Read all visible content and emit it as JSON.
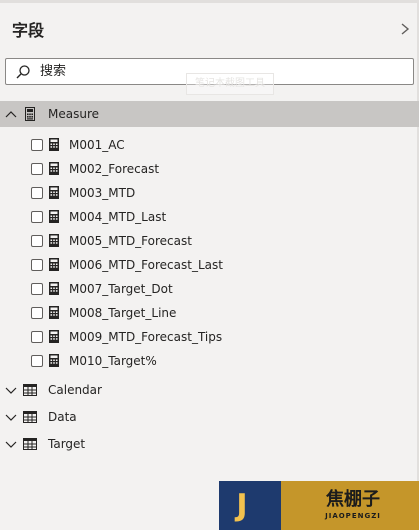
{
  "pane": {
    "title": "字段",
    "collapse_icon": "chevron-right-icon"
  },
  "search": {
    "placeholder": "搜索",
    "value": "",
    "icon": "search-icon"
  },
  "watermark": {
    "text": "笔记本截图工具"
  },
  "tables": [
    {
      "name": "Measure",
      "expanded": true,
      "selected": true,
      "icon": "calculator-icon",
      "fields": [
        {
          "label": "M001_AC",
          "icon": "calculator-icon",
          "checked": false
        },
        {
          "label": "M002_Forecast",
          "icon": "calculator-icon",
          "checked": false
        },
        {
          "label": "M003_MTD",
          "icon": "calculator-icon",
          "checked": false
        },
        {
          "label": "M004_MTD_Last",
          "icon": "calculator-icon",
          "checked": false
        },
        {
          "label": "M005_MTD_Forecast",
          "icon": "calculator-icon",
          "checked": false
        },
        {
          "label": "M006_MTD_Forecast_Last",
          "icon": "calculator-icon",
          "checked": false
        },
        {
          "label": "M007_Target_Dot",
          "icon": "calculator-icon",
          "checked": false
        },
        {
          "label": "M008_Target_Line",
          "icon": "calculator-icon",
          "checked": false
        },
        {
          "label": "M009_MTD_Forecast_Tips",
          "icon": "calculator-icon",
          "checked": false
        },
        {
          "label": "M010_Target%",
          "icon": "calculator-icon",
          "checked": false
        }
      ]
    },
    {
      "name": "Calendar",
      "expanded": false,
      "icon": "table-icon"
    },
    {
      "name": "Data",
      "expanded": false,
      "icon": "table-icon"
    },
    {
      "name": "Target",
      "expanded": false,
      "icon": "table-icon"
    }
  ],
  "logo": {
    "letter": "J",
    "name_cn": "焦棚子",
    "name_en": "JIAOPENGZI",
    "colors": {
      "left": "#1e3a6e",
      "right": "#c5962a",
      "letter": "#f2c14e"
    }
  },
  "colors": {
    "pane_background": "#f3f2f1",
    "selected_row": "#c8c6c4",
    "text": "#252423",
    "search_border": "#8a8886"
  }
}
